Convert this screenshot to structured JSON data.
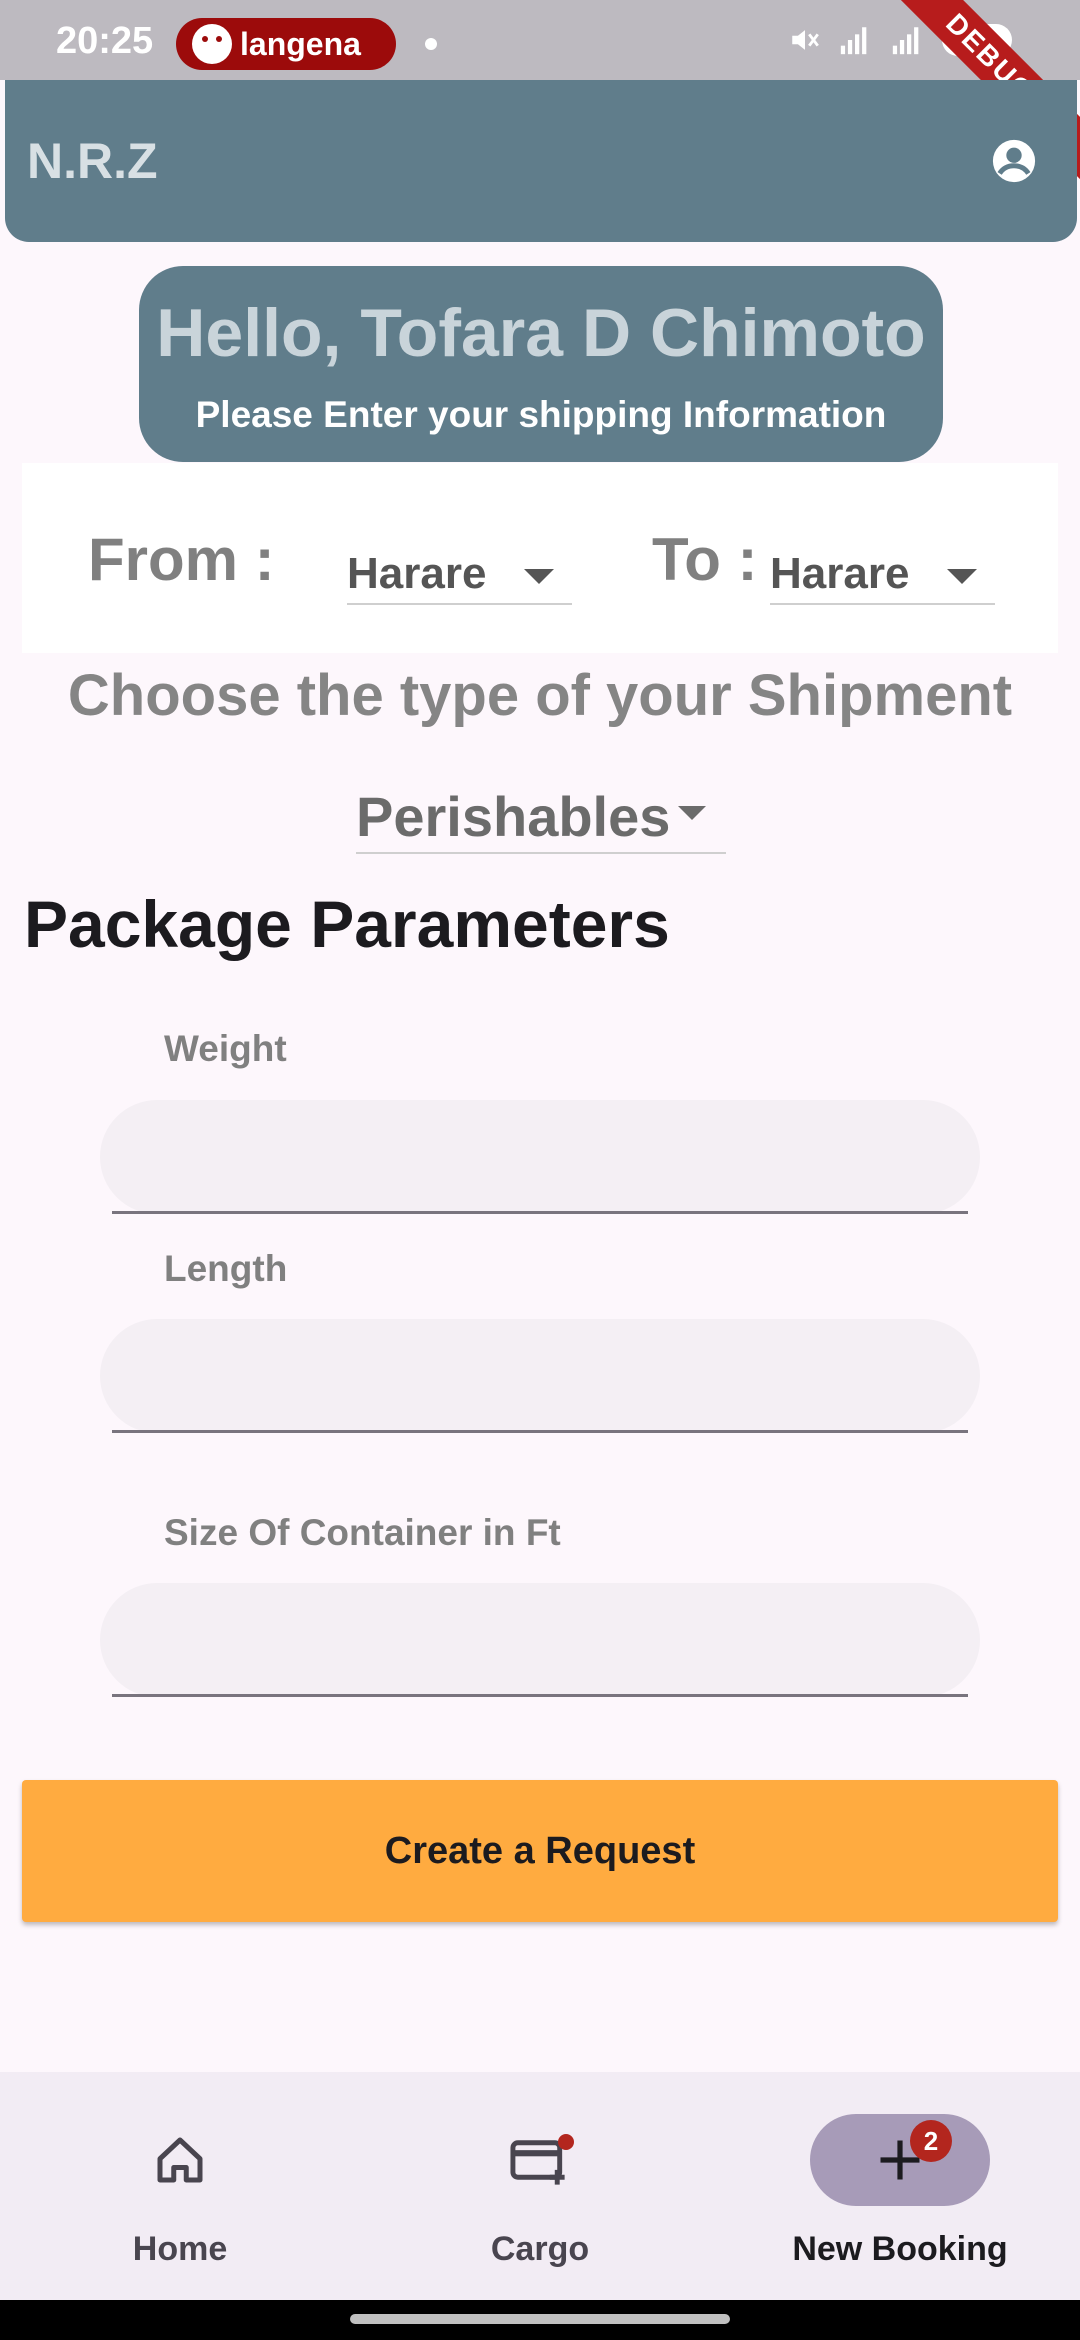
{
  "status_bar": {
    "time": "20:25",
    "notification_app": "langena",
    "debug_label": "DEBUG"
  },
  "app_bar": {
    "title": "N.R.Z",
    "profile_icon": "account-circle-icon"
  },
  "greeting": {
    "title": "Hello, Tofara D Chimoto",
    "subtitle": "Please Enter your shipping Information"
  },
  "route": {
    "from_label": "From :",
    "from_value": "Harare",
    "to_label": "To :",
    "to_value": "Harare"
  },
  "shipment": {
    "title": "Choose the type of your Shipment",
    "selected": "Perishables"
  },
  "package": {
    "title": "Package Parameters",
    "fields": [
      {
        "label": "Weight",
        "value": ""
      },
      {
        "label": "Length",
        "value": ""
      },
      {
        "label": "Size Of Container in Ft",
        "value": ""
      }
    ]
  },
  "actions": {
    "create_label": "Create a Request"
  },
  "bottom_nav": {
    "items": [
      {
        "label": "Home",
        "icon": "home-icon"
      },
      {
        "label": "Cargo",
        "icon": "cargo-card-icon"
      },
      {
        "label": "New Booking",
        "icon": "add-icon",
        "badge": "2"
      }
    ]
  },
  "colors": {
    "app_bar": "#607d8b",
    "accent_button": "#ffab40",
    "active_nav_indicator": "#a79bb8",
    "badge": "#b3261e"
  }
}
